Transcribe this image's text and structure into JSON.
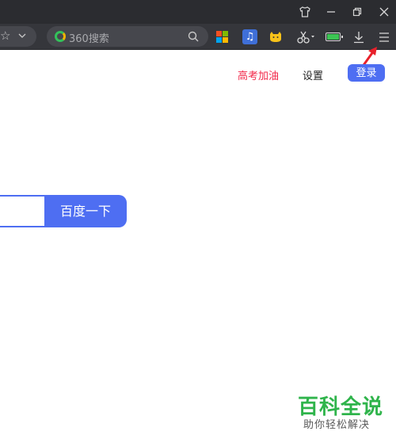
{
  "window": {
    "controls": [
      "shirt-icon",
      "minimize-icon",
      "restore-icon",
      "close-icon"
    ]
  },
  "toolbar": {
    "search_placeholder": "360搜索",
    "icons": [
      "star-icon",
      "chevron-down-icon",
      "search-icon",
      "windows-grid-icon",
      "music-icon",
      "cat-icon",
      "scissors-icon",
      "battery-icon",
      "download-icon",
      "menu-icon"
    ]
  },
  "page": {
    "gaokao_link": "高考加油",
    "settings_link": "设置",
    "login_button": "登录",
    "search_button": "百度一下",
    "search_value": ""
  },
  "watermark": {
    "title": "百科全说",
    "subtitle": "助你轻松解决"
  },
  "colors": {
    "accent": "#4e6ef2",
    "gaokao_red": "#f2294a",
    "watermark_green": "#2fb44b",
    "titlebar": "#2b2c30",
    "toolbar": "#35363b"
  }
}
